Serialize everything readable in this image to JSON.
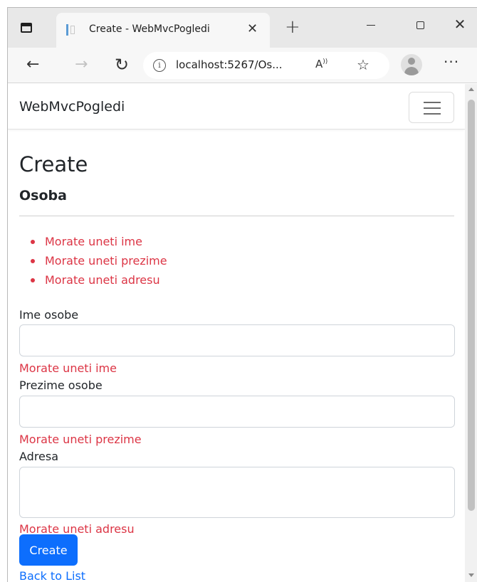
{
  "browser": {
    "tab_title": "Create - WebMvcPogledi",
    "tab_close": "✕",
    "new_tab": "+",
    "address": "localhost:5267/Os...",
    "read_aloud": "A̳)",
    "more": "···",
    "window_close": "✕"
  },
  "site": {
    "brand": "WebMvcPogledi"
  },
  "page": {
    "title": "Create",
    "subtitle": "Osoba",
    "validation_summary": [
      "Morate uneti ime",
      "Morate uneti prezime",
      "Morate uneti adresu"
    ]
  },
  "form": {
    "ime": {
      "label": "Ime osobe",
      "value": "",
      "error": "Morate uneti ime"
    },
    "prezime": {
      "label": "Prezime osobe",
      "value": "",
      "error": "Morate uneti prezime"
    },
    "adresa": {
      "label": "Adresa",
      "value": "",
      "error": "Morate uneti adresu"
    },
    "submit_label": "Create",
    "back_label": "Back to List"
  },
  "colors": {
    "primary": "#0d6efd",
    "danger": "#dc3545"
  }
}
